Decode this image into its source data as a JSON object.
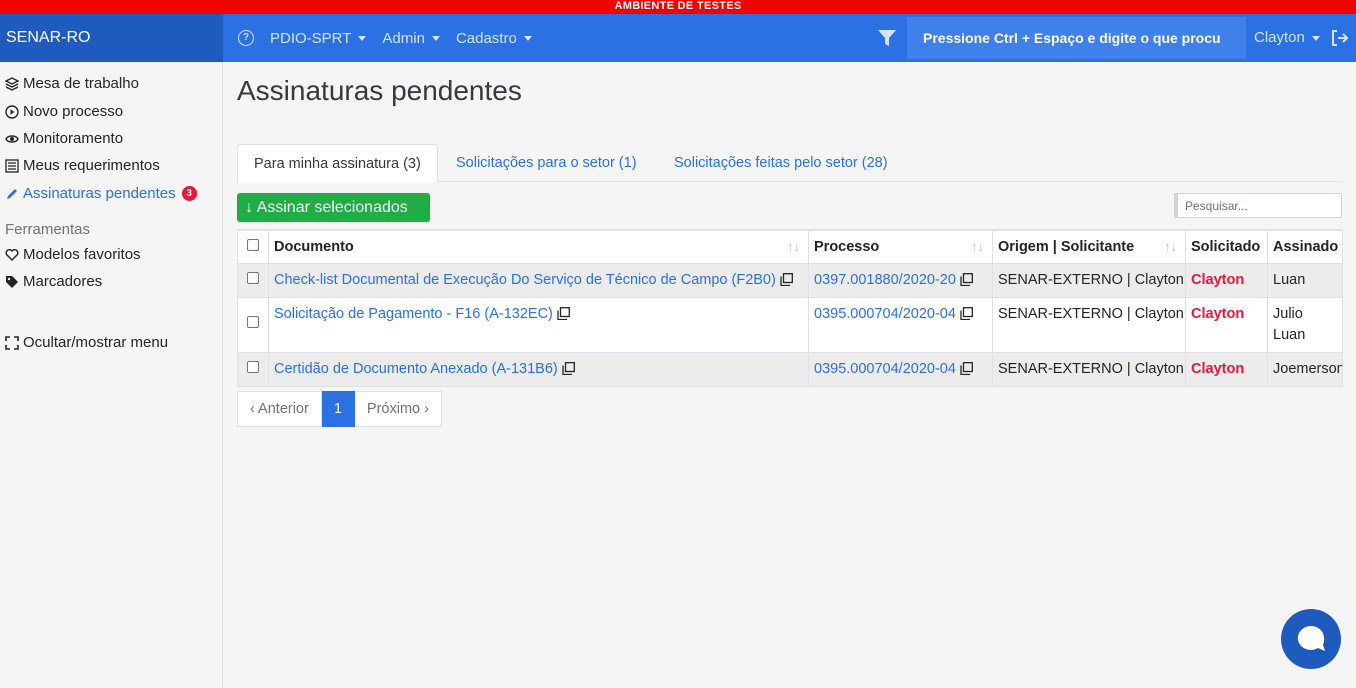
{
  "banner": "AMBIENTE DE TESTES",
  "brand": "SENAR-RO",
  "nav": {
    "menus": [
      "PDIO-SPRT",
      "Admin",
      "Cadastro"
    ],
    "search_text": "Pressione Ctrl + Espaço e digite o que procu",
    "user": "Clayton"
  },
  "sidebar": {
    "items": [
      {
        "label": "Mesa de trabalho",
        "icon": "layers-icon"
      },
      {
        "label": "Novo processo",
        "icon": "play-circle-icon"
      },
      {
        "label": "Monitoramento",
        "icon": "eye-icon"
      },
      {
        "label": "Meus requerimentos",
        "icon": "list-icon"
      },
      {
        "label": "Assinaturas pendentes",
        "icon": "pen-icon",
        "badge": "3"
      }
    ],
    "section": "Ferramentas",
    "tools": [
      {
        "label": "Modelos favoritos",
        "icon": "heart-icon"
      },
      {
        "label": "Marcadores",
        "icon": "tags-icon"
      }
    ],
    "toggle": "Ocultar/mostrar menu"
  },
  "page": {
    "title": "Assinaturas pendentes",
    "tabs": [
      "Para minha assinatura (3)",
      "Solicitações para o setor (1)",
      "Solicitações feitas pelo setor (28)"
    ],
    "sign_button": "↓ Assinar selecionados",
    "search_placeholder": "Pesquisar..."
  },
  "table": {
    "headers": [
      "Documento",
      "Processo",
      "Origem | Solicitante",
      "Solicitado",
      "Assinado"
    ],
    "rows": [
      {
        "documento": "Check-list Documental de Execução Do Serviço de Técnico de Campo (F2B0)",
        "processo": "0397.001880/2020-20",
        "origem": "SENAR-EXTERNO | Clayton",
        "solicitado": "Clayton",
        "assinado": [
          "Luan"
        ]
      },
      {
        "documento": "Solicitação de Pagamento - F16 (A-132EC)",
        "processo": "0395.000704/2020-04",
        "origem": "SENAR-EXTERNO | Clayton",
        "solicitado": "Clayton",
        "assinado": [
          "Julio",
          "Luan"
        ]
      },
      {
        "documento": "Certidão de Documento Anexado (A-131B6)",
        "processo": "0395.000704/2020-04",
        "origem": "SENAR-EXTERNO | Clayton",
        "solicitado": "Clayton",
        "assinado": [
          "Joemerson"
        ]
      }
    ]
  },
  "pagination": {
    "prev": "‹ Anterior",
    "current": "1",
    "next": "Próximo ›"
  },
  "colors": {
    "primary": "#2b71e3",
    "brand_bg": "#1f5bbf",
    "banner": "#f50000",
    "success": "#1fad45",
    "danger": "#e8173b"
  }
}
